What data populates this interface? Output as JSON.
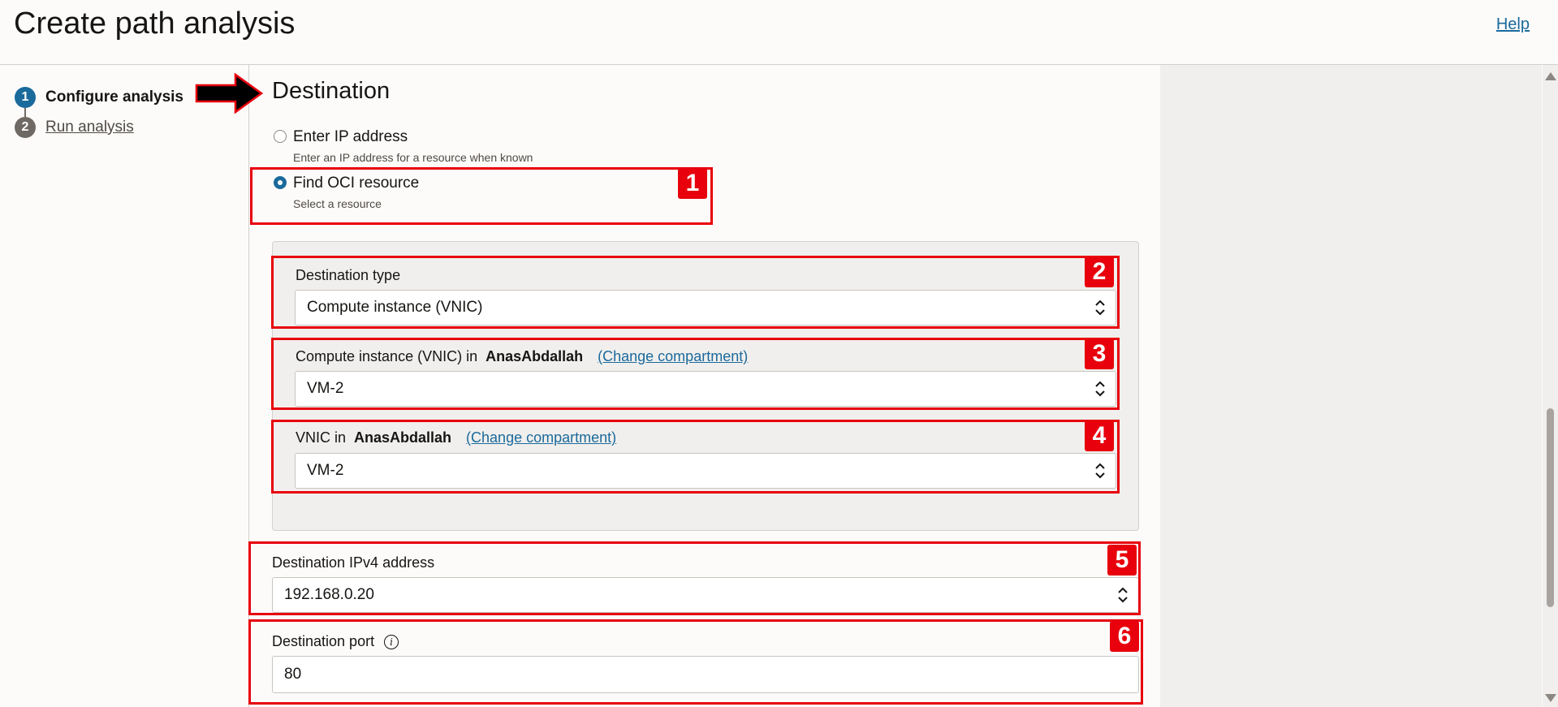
{
  "header": {
    "title": "Create path analysis",
    "help": "Help"
  },
  "steps": [
    {
      "number": "1",
      "label": "Configure analysis"
    },
    {
      "number": "2",
      "label": "Run analysis"
    }
  ],
  "destination": {
    "title": "Destination",
    "option_ip": {
      "label": "Enter IP address",
      "help": "Enter an IP address for a resource when known"
    },
    "option_oci": {
      "label": "Find OCI resource",
      "help": "Select a resource"
    },
    "destination_type": {
      "label": "Destination type",
      "value": "Compute instance (VNIC)"
    },
    "compute_instance": {
      "label": "Compute instance (VNIC) in",
      "compartment": "AnasAbdallah",
      "change_link": "(Change compartment)",
      "value": "VM-2"
    },
    "vnic": {
      "label": "VNIC in",
      "compartment": "AnasAbdallah",
      "change_link": "(Change compartment)",
      "value": "VM-2"
    },
    "ipv4": {
      "label": "Destination IPv4 address",
      "value": "192.168.0.20"
    },
    "port": {
      "label": "Destination port",
      "value": "80"
    }
  },
  "annotations": [
    "1",
    "2",
    "3",
    "4",
    "5",
    "6"
  ],
  "colors": {
    "accent": "#1a6a9c",
    "annotation": "#e8000c"
  }
}
